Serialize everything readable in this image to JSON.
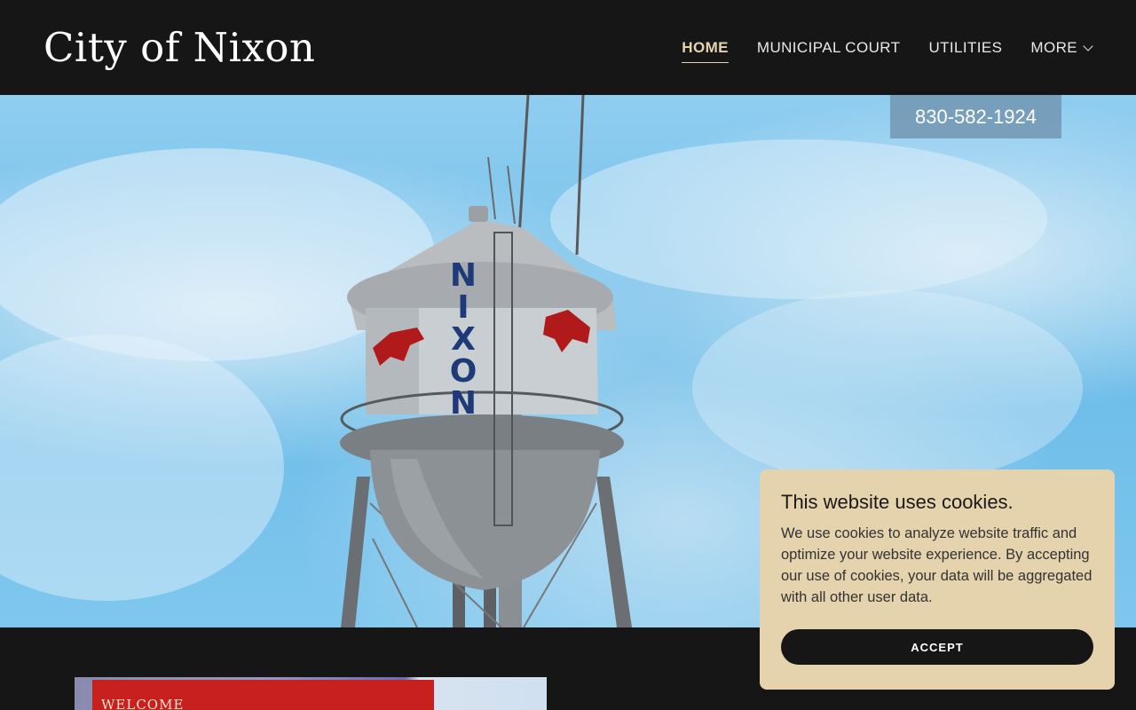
{
  "header": {
    "logo_text": "City of Nixon",
    "nav": [
      {
        "label": "HOME",
        "active": true
      },
      {
        "label": "MUNICIPAL COURT",
        "active": false
      },
      {
        "label": "UTILITIES",
        "active": false
      },
      {
        "label": "MORE",
        "active": false,
        "icon": "chevron-down-icon"
      }
    ]
  },
  "hero": {
    "phone": "830-582-1924",
    "image_text": "NIXON",
    "slides": {
      "count": 6,
      "active_index": 0
    }
  },
  "content": {
    "image_banner_text": "WELCOME"
  },
  "cookie_banner": {
    "title": "This website uses cookies.",
    "body": "We use cookies to analyze website traffic and optimize your website experience. By accepting our use of cookies, your data will be aggregated with all other user data.",
    "accept_label": "ACCEPT"
  },
  "colors": {
    "header_bg": "#161616",
    "active_nav": "#e5d3ae",
    "cookie_bg": "#e4d3ad",
    "button_bg": "#161616"
  }
}
